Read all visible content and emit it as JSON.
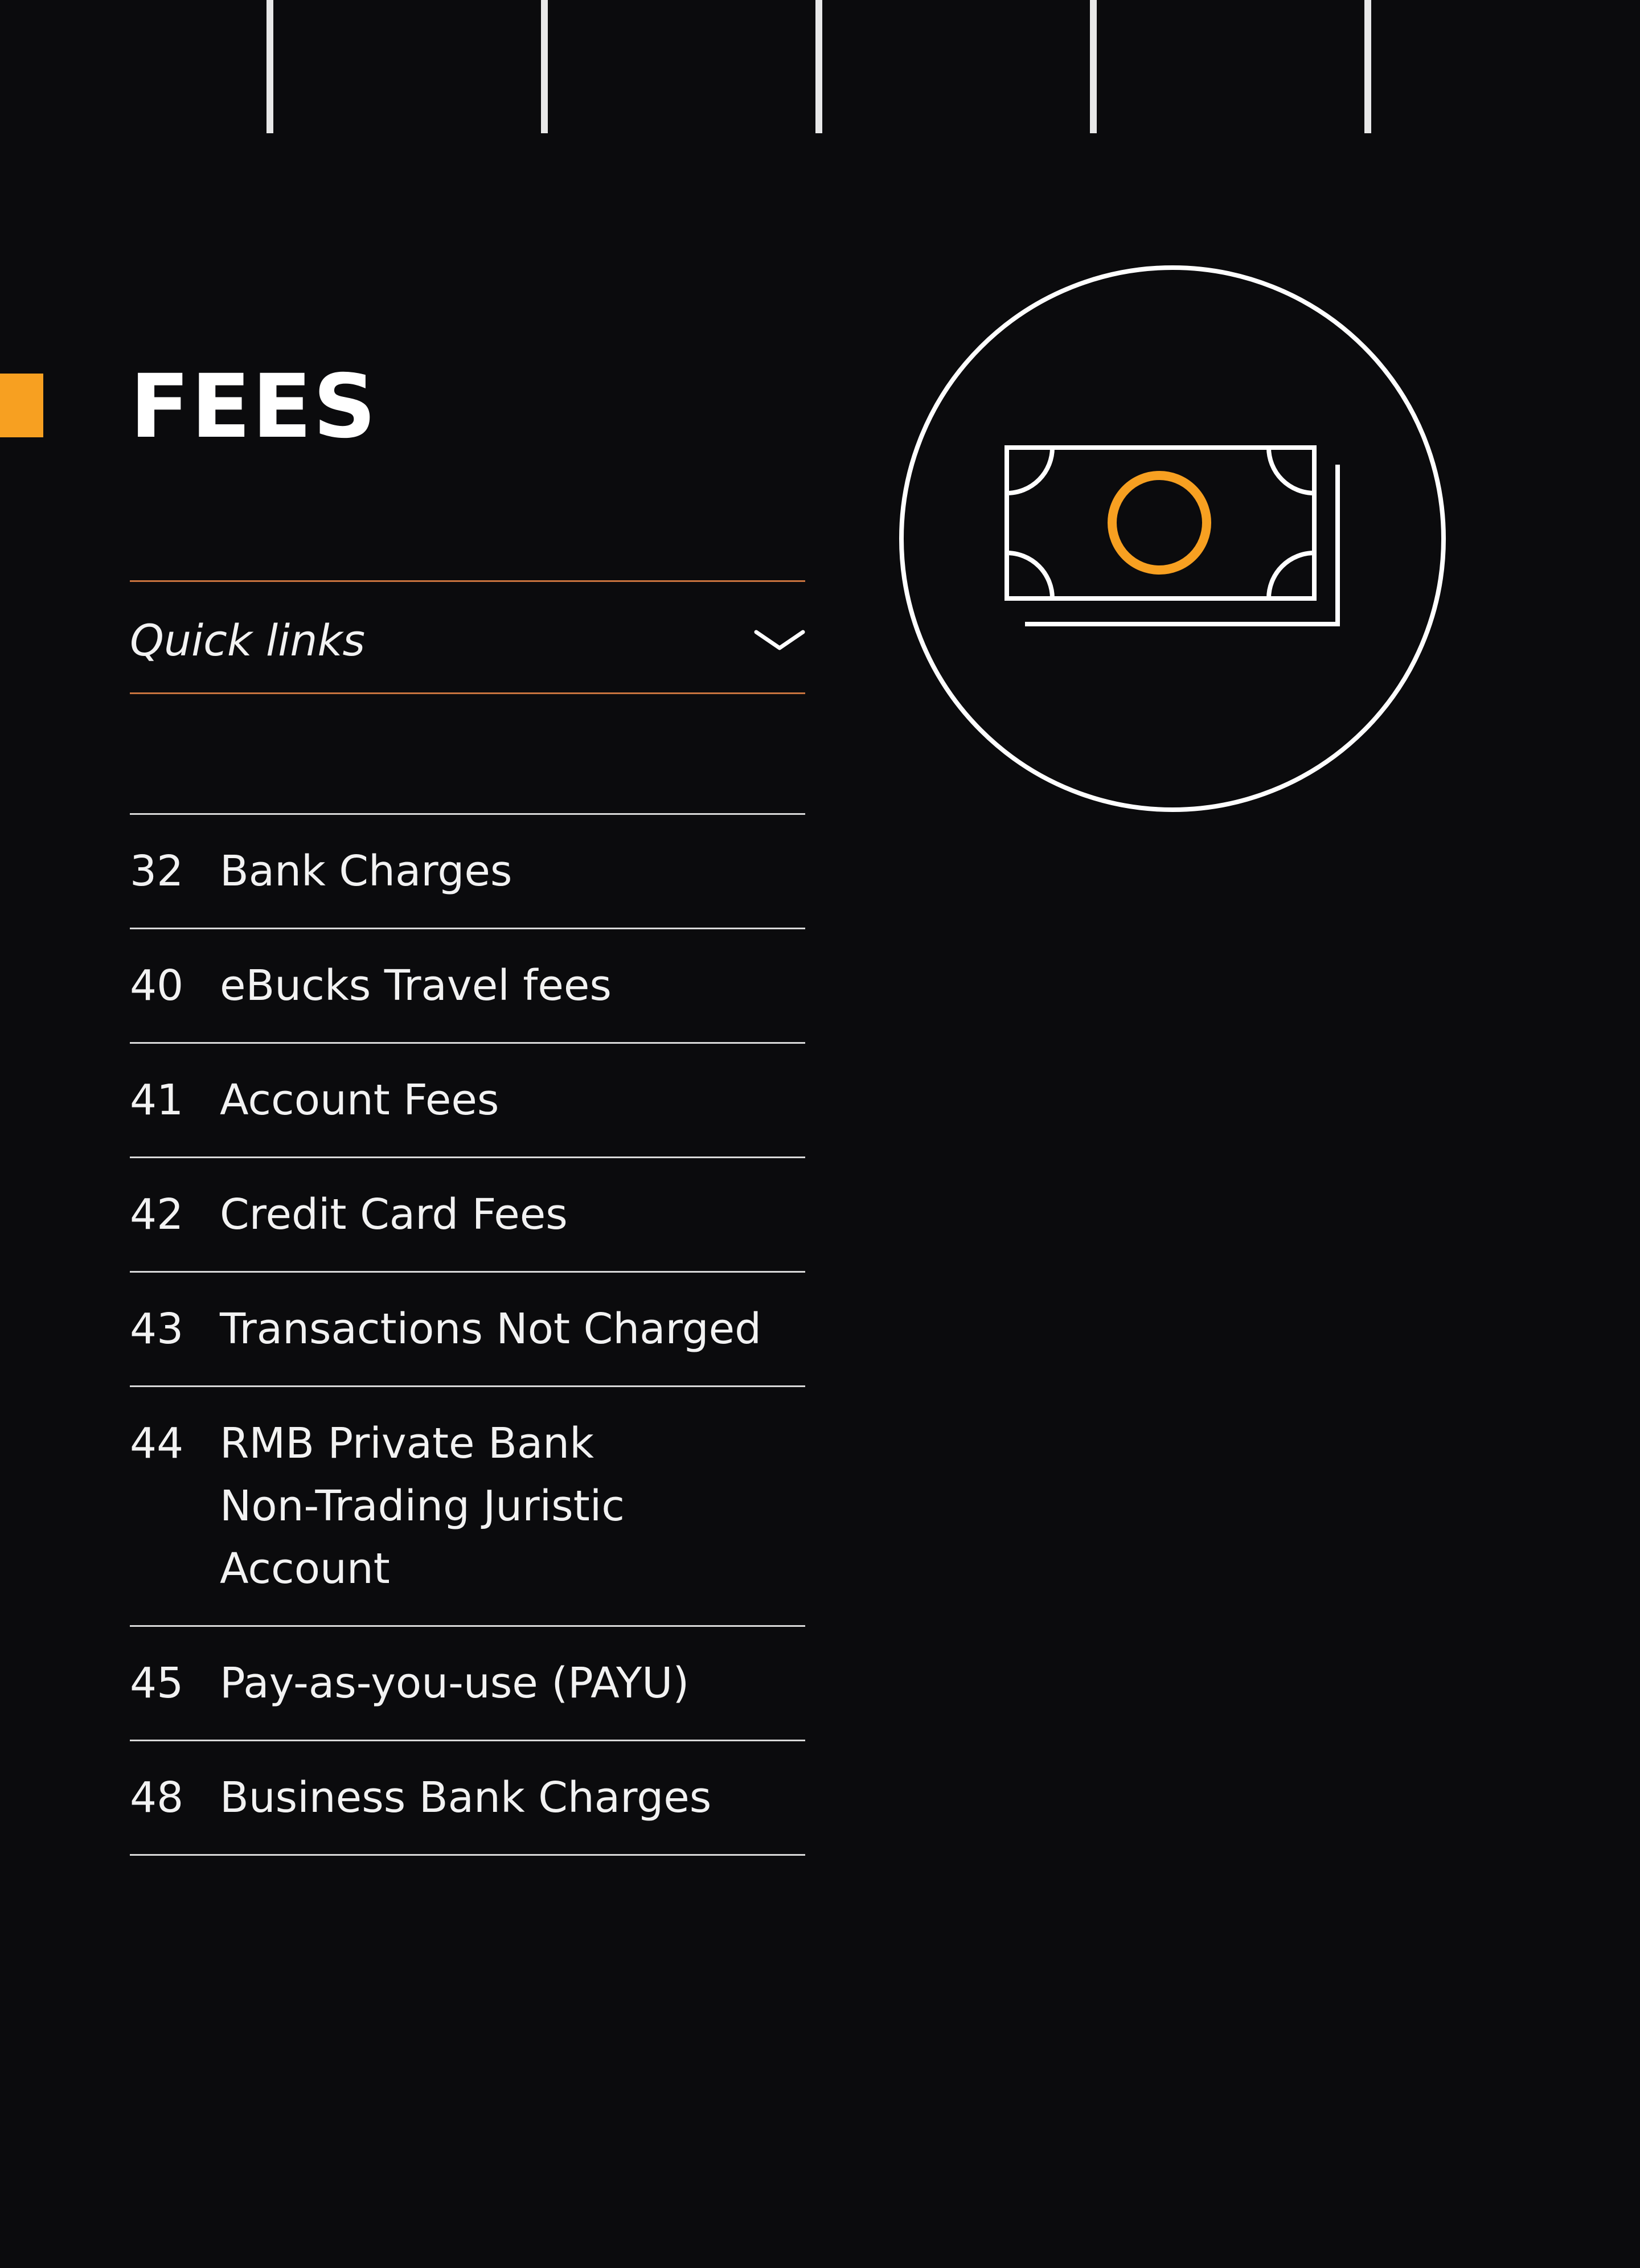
{
  "header": {
    "title": "FEES"
  },
  "quick_links": {
    "label": "Quick links",
    "icon": "chevron-down-icon"
  },
  "toc": {
    "items": [
      {
        "page": "32",
        "title": "Bank Charges"
      },
      {
        "page": "40",
        "title": "eBucks Travel fees"
      },
      {
        "page": "41",
        "title": "Account Fees"
      },
      {
        "page": "42",
        "title": "Credit Card Fees"
      },
      {
        "page": "43",
        "title": "Transactions Not Charged"
      },
      {
        "page": "44",
        "title": "RMB Private Bank\nNon-Trading Juristic\nAccount"
      },
      {
        "page": "45",
        "title": "Pay-as-you-use (PAYU)"
      },
      {
        "page": "48",
        "title": "Business Bank Charges"
      }
    ]
  },
  "illustration": {
    "icon": "banknotes-icon"
  },
  "colors": {
    "background": "#0b0b0d",
    "accent": "#f7a021",
    "divider": "#c8733e",
    "text": "#ffffff"
  }
}
